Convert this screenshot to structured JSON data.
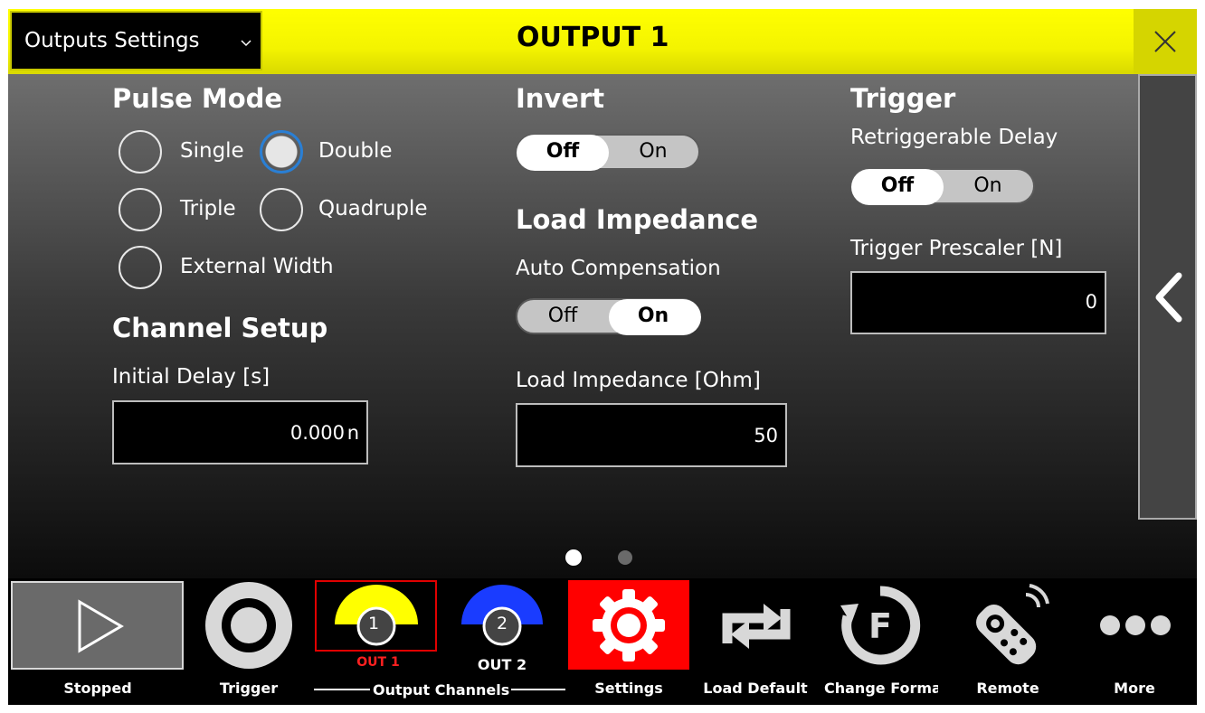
{
  "header": {
    "dropdown_label": "Outputs Settings",
    "title": "OUTPUT 1",
    "close_icon": "close-icon",
    "bg_color": "#ffff00"
  },
  "pulse_mode": {
    "title": "Pulse Mode",
    "options": [
      "Single",
      "Double",
      "Triple",
      "Quadruple",
      "External Width"
    ],
    "selected": "Double"
  },
  "channel_setup": {
    "title": "Channel Setup",
    "initial_delay_label": "Initial Delay [s]",
    "initial_delay_value": "0.000",
    "initial_delay_unit": "n"
  },
  "invert": {
    "title": "Invert",
    "off_label": "Off",
    "on_label": "On",
    "state": "Off"
  },
  "load_impedance": {
    "title": "Load Impedance",
    "auto_comp_label": "Auto Compensation",
    "off_label": "Off",
    "on_label": "On",
    "state": "On",
    "impedance_label": "Load Impedance [Ohm]",
    "impedance_value": "50"
  },
  "trigger": {
    "title": "Trigger",
    "retrig_label": "Retriggerable Delay",
    "off_label": "Off",
    "on_label": "On",
    "state": "Off",
    "prescaler_label": "Trigger Prescaler [N]",
    "prescaler_value": "0"
  },
  "pager": {
    "pages": 2,
    "current": 1
  },
  "toolbar": {
    "stopped_label": "Stopped",
    "trigger_label": "Trigger",
    "out1_number": "1",
    "out1_label": "OUT 1",
    "out2_number": "2",
    "out2_label": "OUT 2",
    "output_channels_label": "Output Channels",
    "settings_label": "Settings",
    "load_default_label": "Load Default",
    "change_format_label": "Change Format",
    "remote_label": "Remote",
    "more_label": "More",
    "colors": {
      "out1": "#ffff00",
      "out2": "#1a3cff",
      "settings_bg": "#ff0000",
      "out1_label": "#ff2020"
    }
  }
}
